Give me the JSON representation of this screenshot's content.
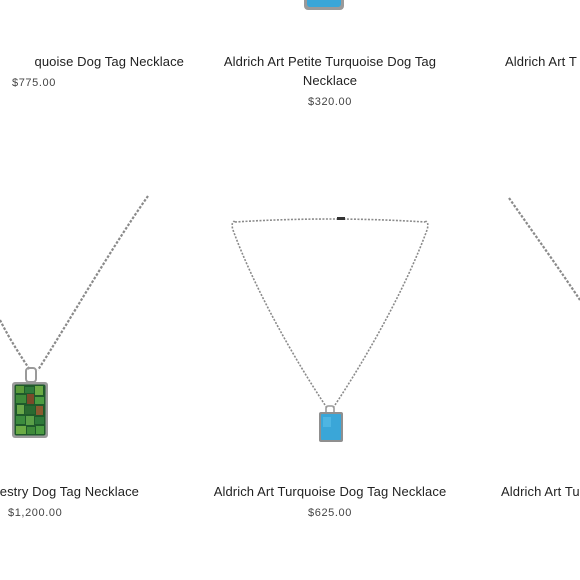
{
  "products": [
    {
      "name": "Aldrich Art Turquoise Dog Tag Necklace",
      "visible_name": "quoise Dog Tag Necklace",
      "price": "$775.00"
    },
    {
      "name": "Aldrich Art Petite Turquoise Dog Tag Necklace",
      "price": "$320.00"
    },
    {
      "name": "Aldrich Art T",
      "price": ""
    },
    {
      "name": "estry Dog Tag Necklace",
      "price": "$1,200.00"
    },
    {
      "name": "Aldrich Art Turquoise Dog Tag Necklace",
      "price": "$625.00"
    },
    {
      "name": "Aldrich Art Tu",
      "price": ""
    }
  ],
  "colors": {
    "chain": "#8a8a8a",
    "turquoise": "#3aa6d8",
    "mosaic_green": "#2f7a3a",
    "bezel": "#9a9a9a"
  }
}
